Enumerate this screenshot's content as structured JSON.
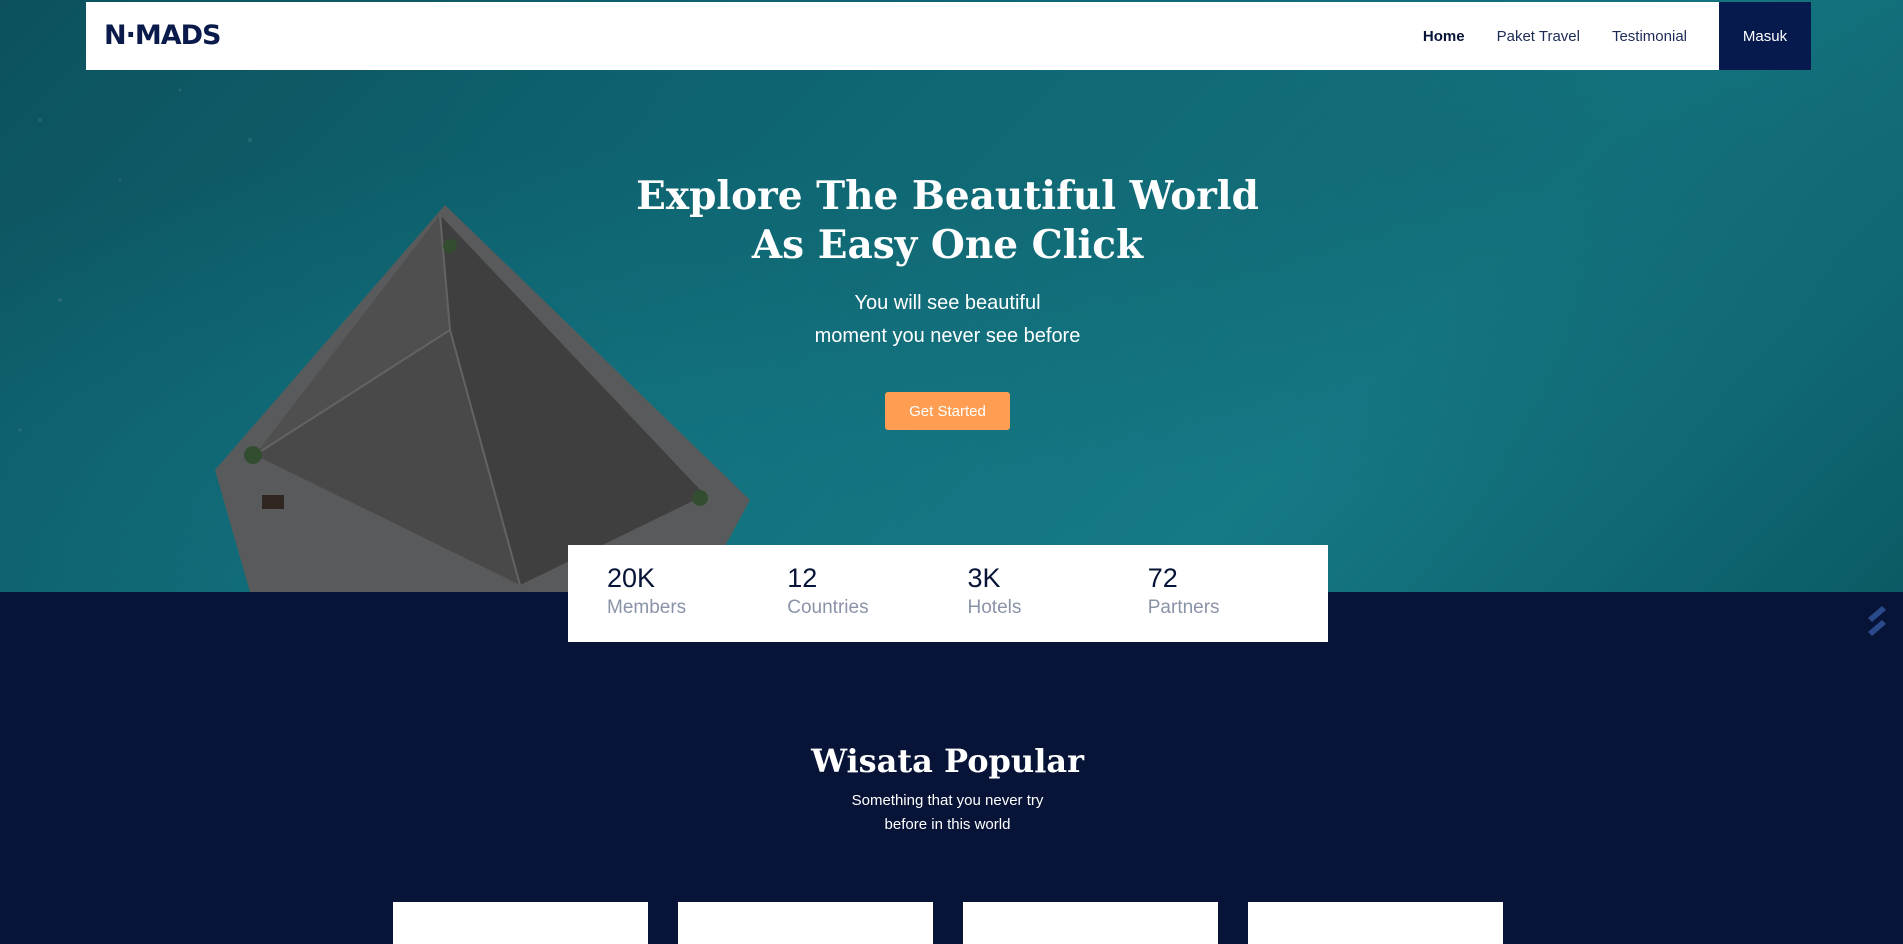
{
  "navbar": {
    "logo": "N·MADS",
    "links": [
      {
        "label": "Home",
        "active": true
      },
      {
        "label": "Paket Travel",
        "active": false
      },
      {
        "label": "Testimonial",
        "active": false
      }
    ],
    "login_label": "Masuk"
  },
  "hero": {
    "title_line1": "Explore The Beautiful World",
    "title_line2": "As Easy One Click",
    "subtitle_line1": "You will see beautiful",
    "subtitle_line2": "moment you never see before",
    "cta_label": "Get Started"
  },
  "stats": [
    {
      "value": "20K",
      "label": "Members"
    },
    {
      "value": "12",
      "label": "Countries"
    },
    {
      "value": "3K",
      "label": "Hotels"
    },
    {
      "value": "72",
      "label": "Partners"
    }
  ],
  "popular": {
    "title": "Wisata Popular",
    "subtitle_line1": "Something that you never try",
    "subtitle_line2": "before in this world"
  },
  "colors": {
    "navy": "#071437",
    "accent_orange": "#ff9e53",
    "login_bg": "#071a4d"
  }
}
